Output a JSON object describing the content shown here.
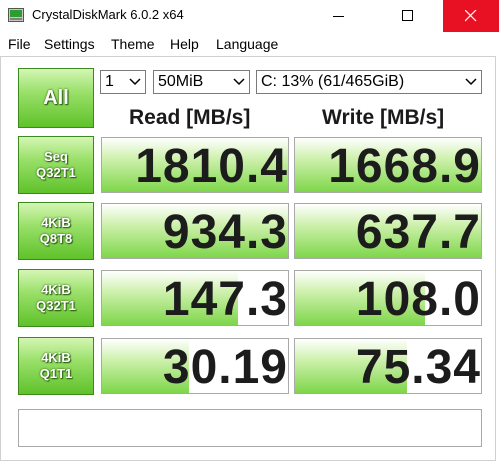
{
  "window": {
    "title": "CrystalDiskMark 6.0.2 x64"
  },
  "menu": {
    "items": [
      "File",
      "Settings",
      "Theme",
      "Help",
      "Language"
    ]
  },
  "controls": {
    "all_label": "All",
    "test_count": "1",
    "test_size": "50MiB",
    "drive": "C: 13% (61/465GiB)"
  },
  "columns": {
    "read": "Read [MB/s]",
    "write": "Write [MB/s]"
  },
  "rows": [
    {
      "label_line1": "Seq",
      "label_line2": "Q32T1",
      "read": "1810.4",
      "write": "1668.9",
      "read_fill": 1.0,
      "write_fill": 1.0
    },
    {
      "label_line1": "4KiB",
      "label_line2": "Q8T8",
      "read": "934.3",
      "write": "637.7",
      "read_fill": 1.0,
      "write_fill": 1.0
    },
    {
      "label_line1": "4KiB",
      "label_line2": "Q32T1",
      "read": "147.3",
      "write": "108.0",
      "read_fill": 0.73,
      "write_fill": 0.7
    },
    {
      "label_line1": "4KiB",
      "label_line2": "Q1T1",
      "read": "30.19",
      "write": "75.34",
      "read_fill": 0.47,
      "write_fill": 0.6
    }
  ],
  "comment": "",
  "colors": {
    "accent_green": "#5fc22a",
    "close_red": "#e81123"
  }
}
